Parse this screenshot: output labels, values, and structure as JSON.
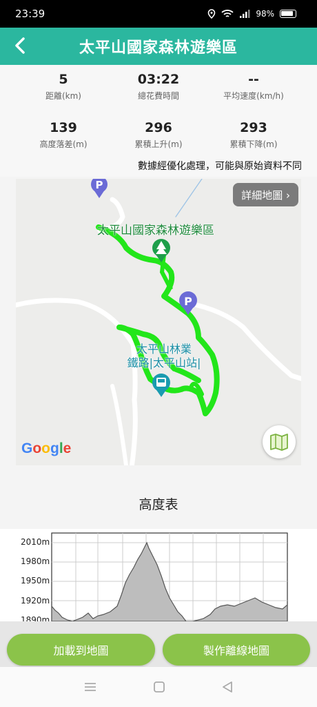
{
  "status": {
    "time": "23:39",
    "battery": "98%"
  },
  "app_bar": {
    "title": "太平山國家森林遊樂區"
  },
  "stats": [
    {
      "value": "5",
      "label": "距離(km)"
    },
    {
      "value": "03:22",
      "label": "總花費時間"
    },
    {
      "value": "--",
      "label": "平均速度(km/h)"
    },
    {
      "value": "139",
      "label": "高度落差(m)"
    },
    {
      "value": "296",
      "label": "累積上升(m)"
    },
    {
      "value": "293",
      "label": "累積下降(m)"
    }
  ],
  "note": "數據經優化處理，可能與原始資料不同",
  "map": {
    "detail_button": "詳細地圖 ›",
    "place_label": "太平山國家森林遊樂區",
    "station_label_1": "太平山林業",
    "station_label_2": "鐵路|太平山站|",
    "google": "Google",
    "route_color": "#22e61a"
  },
  "elevation": {
    "title": "高度表",
    "y_ticks": [
      "2010m",
      "1980m",
      "1950m",
      "1920m",
      "1890m"
    ]
  },
  "buttons": {
    "load_to_map": "加載到地圖",
    "make_offline_map": "製作離線地圖"
  }
}
